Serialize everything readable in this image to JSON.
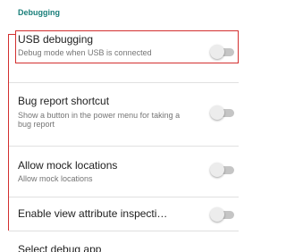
{
  "section": {
    "header": "Debugging"
  },
  "prefs": [
    {
      "title": "USB debugging",
      "summary": "Debug mode when USB is connected",
      "toggle_on": false
    },
    {
      "title": "Bug report shortcut",
      "summary": "Show a button in the power menu for taking a bug report",
      "toggle_on": false
    },
    {
      "title": "Allow mock locations",
      "summary": "Allow mock locations",
      "toggle_on": false
    },
    {
      "title": "Enable view attribute inspecti…",
      "summary": "",
      "toggle_on": false
    },
    {
      "title": "Select debug app",
      "summary": "",
      "toggle_on": null
    }
  ],
  "colors": {
    "accent": "#1a7f7a",
    "annotation": "#d32f2f",
    "toggle_track_off": "#c5c5c5",
    "toggle_thumb_off": "#ececec"
  }
}
